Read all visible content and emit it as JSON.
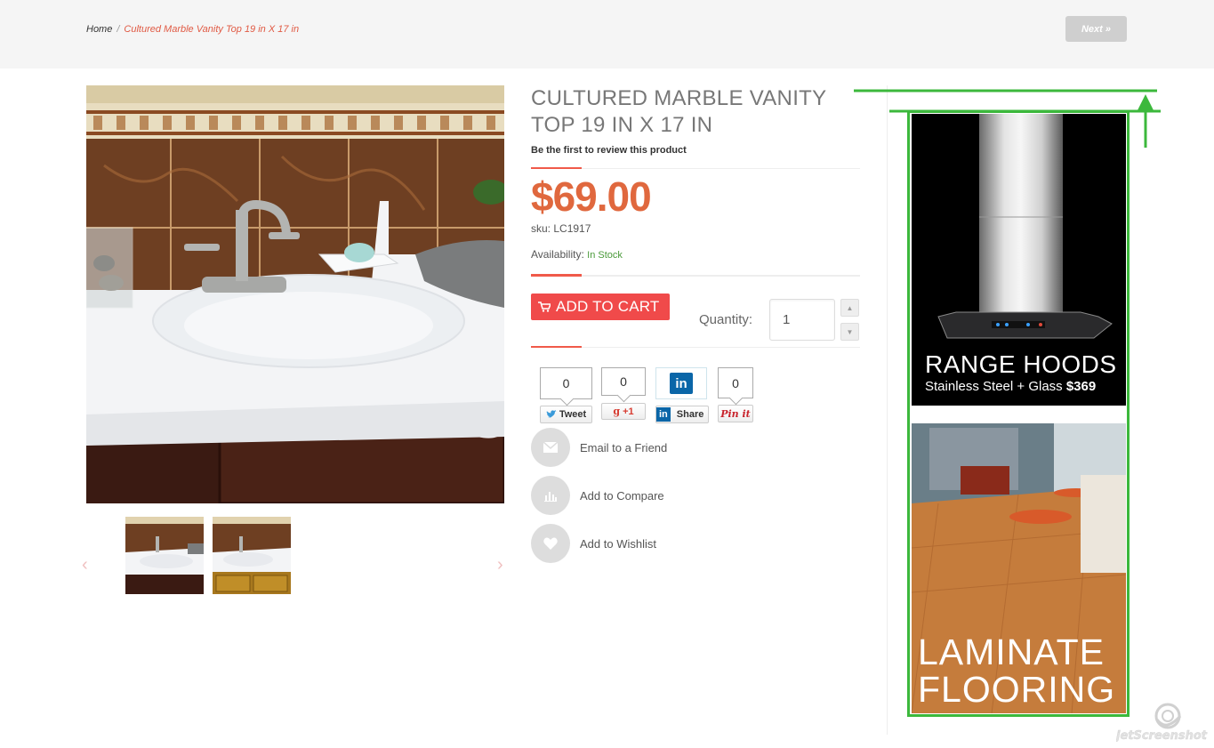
{
  "breadcrumb": {
    "home": "Home",
    "separator": "/",
    "current": "Cultured Marble Vanity Top 19 in X 17 in"
  },
  "nav": {
    "next_label": "Next »"
  },
  "product": {
    "title": "CULTURED MARBLE VANITY TOP 19 IN X 17 IN",
    "review_link": "Be the first to review this product",
    "price": "$69.00",
    "sku_label": "sku:",
    "sku_value": "LC1917",
    "availability_label": "Availability:",
    "availability_value": "In Stock",
    "add_to_cart": "ADD TO CART",
    "quantity_label": "Quantity:",
    "quantity_value": "1"
  },
  "share": [
    {
      "name": "twitter",
      "count": "0",
      "label": "Tweet"
    },
    {
      "name": "google-plus",
      "count": "0",
      "label": "+1"
    },
    {
      "name": "linkedin",
      "count": "",
      "label": "Share"
    },
    {
      "name": "pinterest",
      "count": "0",
      "label": "Pin it"
    }
  ],
  "actions": [
    {
      "icon": "envelope-icon",
      "label": "Email to a Friend"
    },
    {
      "icon": "bar-chart-icon",
      "label": "Add to Compare"
    },
    {
      "icon": "heart-icon",
      "label": "Add to Wishlist"
    }
  ],
  "ads": {
    "ad1_title": "RANGE HOODS",
    "ad1_sub": "Stainless Steel + Glass",
    "ad1_price": "$369",
    "ad2_line1": "LAMINATE",
    "ad2_line2": "FLOORING"
  },
  "colors": {
    "accent": "#f04a4a",
    "price": "#e0683e",
    "in_stock": "#4a9a3a",
    "ad_border": "#3cb83c"
  }
}
